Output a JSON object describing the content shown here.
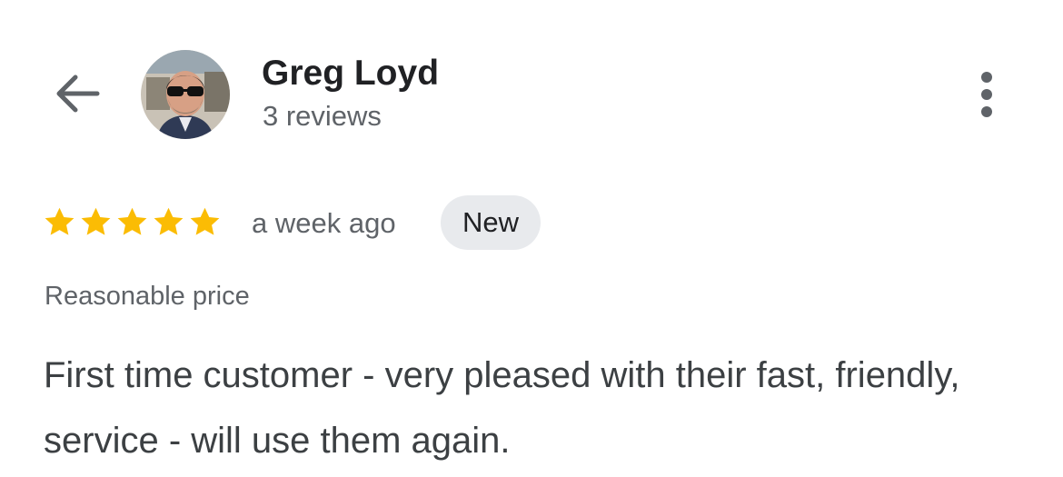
{
  "header": {
    "back_icon": "arrow-left-icon",
    "avatar_icon": "reviewer-photo",
    "more_icon": "more-vertical-icon"
  },
  "reviewer": {
    "name": "Greg Loyd",
    "review_count": "3 reviews"
  },
  "review": {
    "rating": 5,
    "max_rating": 5,
    "star_color": "#fbbc04",
    "timestamp": "a week ago",
    "badge": "New",
    "attribute": "Reasonable price",
    "text": "First time customer - very pleased with their fast, friendly, service - will use them again."
  }
}
